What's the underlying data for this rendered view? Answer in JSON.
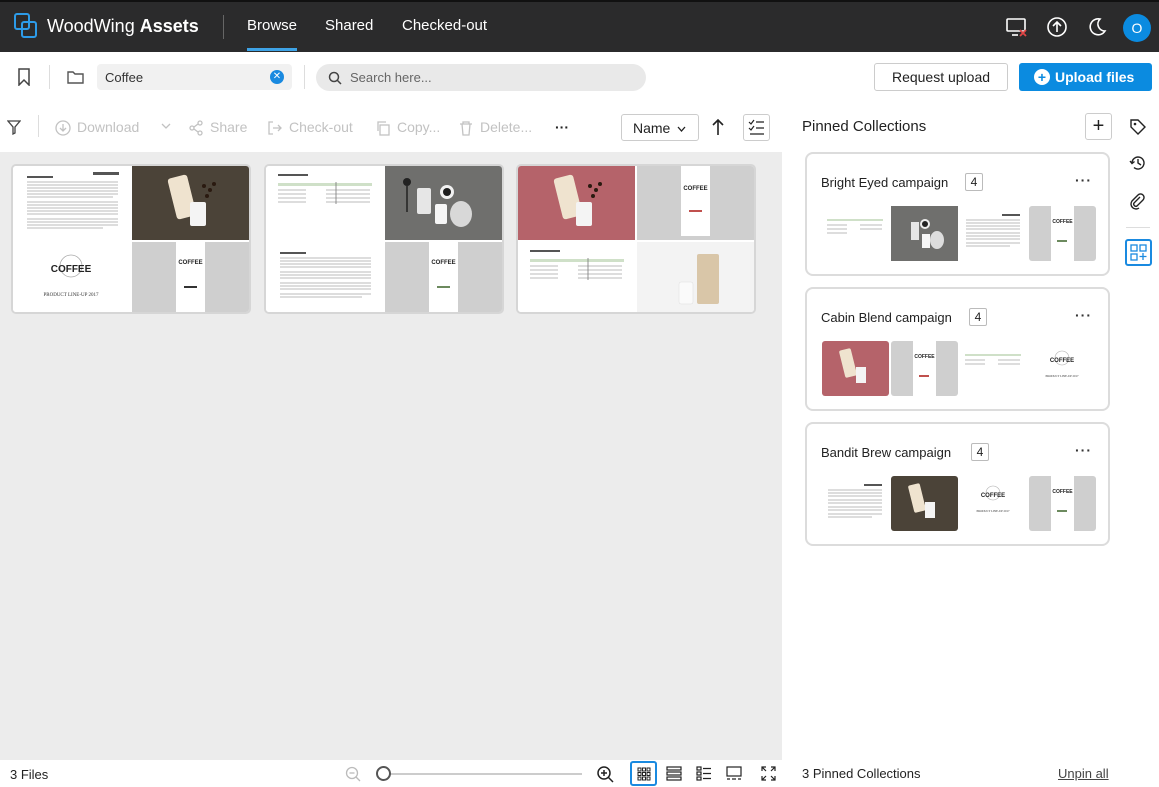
{
  "app": {
    "brand_light": "WoodWing",
    "brand_bold": "Assets"
  },
  "nav": {
    "tabs": [
      {
        "label": "Browse"
      },
      {
        "label": "Shared"
      },
      {
        "label": "Checked-out"
      }
    ],
    "active_tab": "Browse"
  },
  "user": {
    "initial": "O"
  },
  "location": {
    "folder": "Coffee"
  },
  "search": {
    "placeholder": "Search here..."
  },
  "actions": {
    "request_upload": "Request upload",
    "upload_files": "Upload files"
  },
  "toolbar": {
    "download": "Download",
    "share": "Share",
    "checkout": "Check-out",
    "copy": "Copy...",
    "delete": "Delete...",
    "more": "···",
    "sort_field": "Name"
  },
  "files": {
    "count_label": "3 Files"
  },
  "thumb_text": {
    "coffee": "COFFEE",
    "product_lineup": "PRODUCT LINE-UP 2017"
  },
  "pinned": {
    "title": "Pinned Collections",
    "collections": [
      {
        "name": "Bright Eyed campaign",
        "count": "4"
      },
      {
        "name": "Cabin Blend campaign",
        "count": "4"
      },
      {
        "name": "Bandit Brew campaign",
        "count": "4"
      }
    ],
    "footer_count": "3 Pinned Collections",
    "unpin_all": "Unpin all"
  },
  "colors": {
    "accent": "#0b8be0",
    "topbar": "#2b2b2c",
    "grid_bg": "#ececec"
  }
}
